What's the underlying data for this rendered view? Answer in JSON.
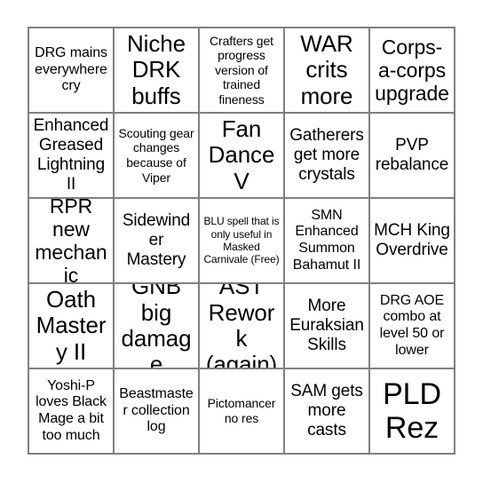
{
  "card": {
    "type": "bingo-card",
    "rows": 5,
    "columns": 5,
    "border_color": "#808080",
    "background_color": "#ffffff",
    "text_color": "#000000",
    "cells": [
      {
        "text": "DRG mains everywhere cry",
        "size": "sm"
      },
      {
        "text": "Niche DRK buffs",
        "size": "xl"
      },
      {
        "text": "Crafters get progress version of trained fineness",
        "size": "xs"
      },
      {
        "text": "WAR crits more",
        "size": "xl"
      },
      {
        "text": "Corps-a-corps upgrade",
        "size": "lg"
      },
      {
        "text": "Enhanced Greased Lightning II",
        "size": "md"
      },
      {
        "text": "Scouting gear changes because of Viper",
        "size": "xs"
      },
      {
        "text": "Fan Dance V",
        "size": "xl"
      },
      {
        "text": "Gatherers get more crystals",
        "size": "md"
      },
      {
        "text": "PVP rebalance",
        "size": "md"
      },
      {
        "text": "RPR new mechanic",
        "size": "lg"
      },
      {
        "text": "Sidewinder Mastery",
        "size": "md"
      },
      {
        "text": "BLU spell that is only useful in Masked Carnivale (Free)",
        "size": "xxs"
      },
      {
        "text": "SMN Enhanced Summon Bahamut II",
        "size": "sm"
      },
      {
        "text": "MCH King Overdrive",
        "size": "md"
      },
      {
        "text": "Oath Mastery II",
        "size": "xl"
      },
      {
        "text": "GNB big damage",
        "size": "xl"
      },
      {
        "text": "AST Rework (again)",
        "size": "xl"
      },
      {
        "text": "More Euraksian Skills",
        "size": "md"
      },
      {
        "text": "DRG AOE combo at level 50 or lower",
        "size": "sm"
      },
      {
        "text": "Yoshi-P loves Black Mage a bit too much",
        "size": "sm"
      },
      {
        "text": "Beastmaster collection log",
        "size": "sm"
      },
      {
        "text": "Pictomancer no res",
        "size": "xs"
      },
      {
        "text": "SAM gets more casts",
        "size": "md"
      },
      {
        "text": "PLD Rez",
        "size": "xxl"
      }
    ]
  }
}
